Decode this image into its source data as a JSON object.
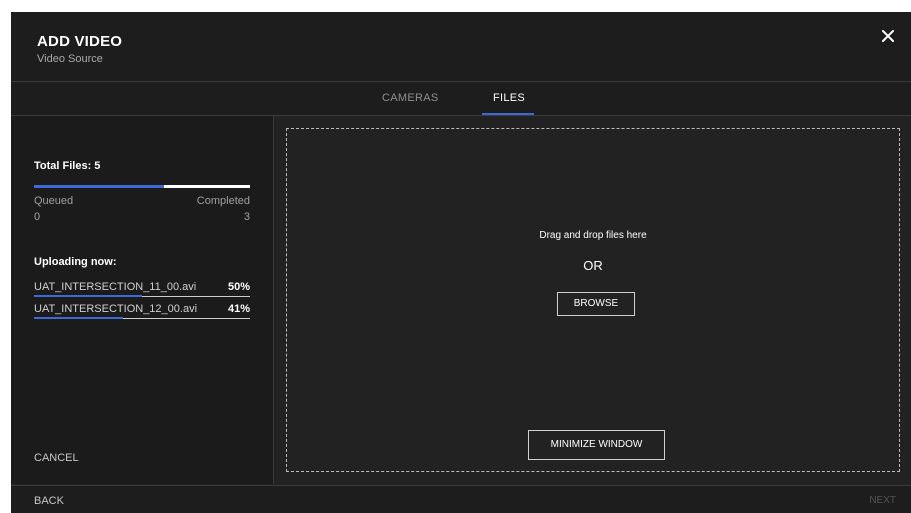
{
  "dialog": {
    "title": "ADD VIDEO",
    "subtitle": "Video Source",
    "close_icon": "close-icon"
  },
  "tabs": [
    {
      "label": "CAMERAS",
      "active": false
    },
    {
      "label": "FILES",
      "active": true
    }
  ],
  "upload": {
    "total_label": "Total Files: 5",
    "total_files": 5,
    "progress_fraction": 0.6,
    "queued_label": "Queued",
    "queued_value": "0",
    "completed_label": "Completed",
    "completed_value": "3",
    "uploading_label": "Uploading now:",
    "files": [
      {
        "name": "UAT_INTERSECTION_11_00.avi",
        "percent": "50%",
        "progress": 0.5
      },
      {
        "name": "UAT_INTERSECTION_12_00.avi",
        "percent": "41%",
        "progress": 0.41
      }
    ],
    "cancel_label": "CANCEL"
  },
  "dropzone": {
    "drag_text": "Drag and drop files here",
    "or_text": "OR",
    "browse_label": "BROWSE",
    "minimize_label": "MINIMIZE WINDOW"
  },
  "footer": {
    "back_label": "BACK",
    "next_label": "NEXT"
  },
  "colors": {
    "accent": "#3d6ad6",
    "background": "#222222",
    "text": "#ffffff"
  }
}
